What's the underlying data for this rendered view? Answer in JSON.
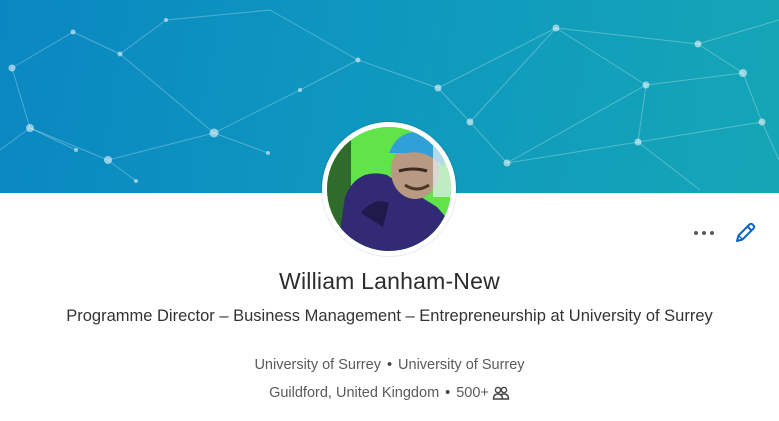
{
  "profile": {
    "name": "William Lanham-New",
    "headline": "Programme Director – Business Management – Entrepreneurship at University of Surrey",
    "company": "University of Surrey",
    "school": "University of Surrey",
    "location": "Guildford, United Kingdom",
    "connections": "500+",
    "separator": "•"
  },
  "icons": {
    "more": "more-horizontal-icon",
    "edit": "pencil-icon",
    "connections": "people-icon"
  },
  "colors": {
    "cover_start": "#0a87c2",
    "cover_end": "#15a6b6",
    "edit_icon": "#0a66c2",
    "text_primary": "#2c2c2c",
    "text_secondary": "#5a5a5a"
  }
}
